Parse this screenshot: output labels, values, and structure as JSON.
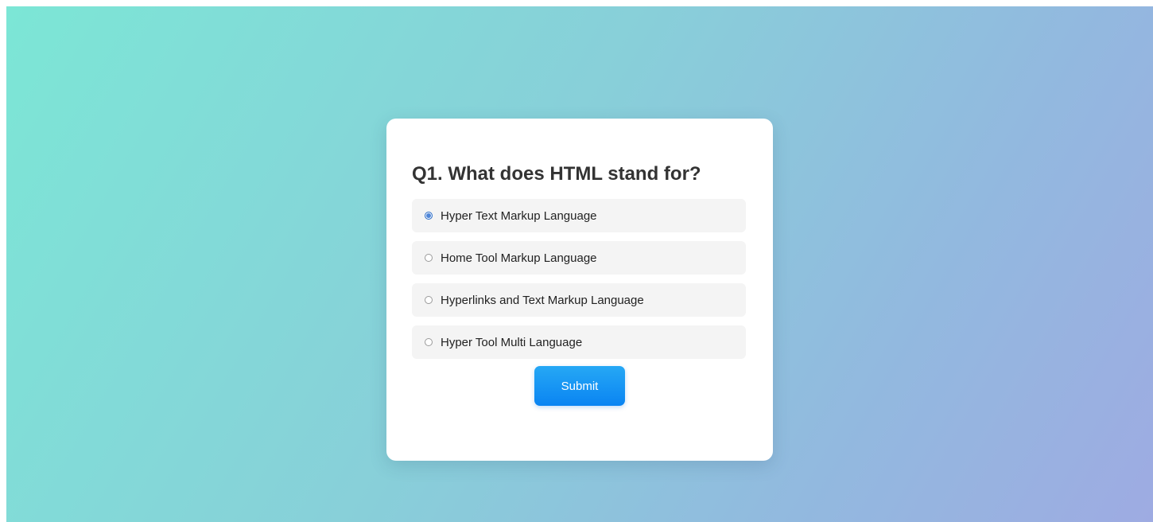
{
  "colors": {
    "background_start": "#7ce6d6",
    "background_end": "#9eabe2",
    "card": "#ffffff",
    "option_bg": "#f4f4f4",
    "accent": "#0a84f2"
  },
  "quiz": {
    "question": "Q1. What does HTML stand for?",
    "options": [
      {
        "label": "Hyper Text Markup Language",
        "selected": true
      },
      {
        "label": "Home Tool Markup Language",
        "selected": false
      },
      {
        "label": "Hyperlinks and Text Markup Language",
        "selected": false
      },
      {
        "label": "Hyper Tool Multi Language",
        "selected": false
      }
    ],
    "submit_label": "Submit"
  }
}
